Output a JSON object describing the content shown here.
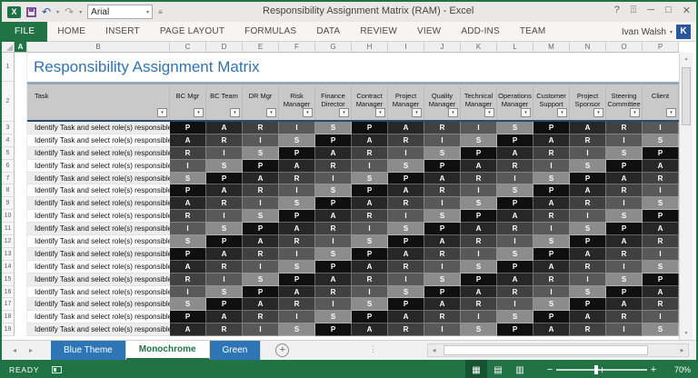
{
  "window": {
    "title": "Responsibility Assignment Matrix (RAM) - Excel",
    "user_name": "Ivan Walsh",
    "user_initial": "K",
    "font_box_value": "Arial"
  },
  "ribbon": {
    "file_tab": "FILE",
    "tabs": [
      "HOME",
      "INSERT",
      "PAGE LAYOUT",
      "FORMULAS",
      "DATA",
      "REVIEW",
      "VIEW",
      "ADD-INS",
      "TEAM"
    ]
  },
  "sheet": {
    "column_letters": [
      "A",
      "B",
      "C",
      "D",
      "E",
      "F",
      "G",
      "H",
      "I",
      "J",
      "K",
      "L",
      "M",
      "N",
      "O",
      "P"
    ],
    "selected_column": "A",
    "row_numbers": [
      "1",
      "2",
      "3",
      "4",
      "5",
      "6",
      "7",
      "8",
      "9",
      "10",
      "11",
      "12",
      "13",
      "14",
      "15",
      "16",
      "17",
      "18",
      "19"
    ],
    "title": "Responsibility Assignment Matrix",
    "headers": [
      "Task",
      "BC Mgr",
      "BC Team",
      "DR Mgr",
      "Risk Manager",
      "Finance Director",
      "Contract Manager",
      "Project Manager",
      "Quality Manager",
      "Technical Manager",
      "Operations Manager",
      "Customer Support",
      "Project Sponsor",
      "Steering Committee",
      "Client"
    ],
    "task_text": "Identify Task and select role(s) responsible",
    "cell_colors": {
      "P": "#0f0f0f",
      "A": "#272727",
      "R": "#414141",
      "I": "#595959",
      "S": "#8c8c8c"
    },
    "band_colors": [
      "#ededed",
      "#fdfdfd"
    ],
    "rows": [
      [
        "P",
        "A",
        "R",
        "I",
        "S",
        "P",
        "A",
        "R",
        "I",
        "S",
        "P",
        "A",
        "R",
        "I"
      ],
      [
        "A",
        "R",
        "I",
        "S",
        "P",
        "A",
        "R",
        "I",
        "S",
        "P",
        "A",
        "R",
        "I",
        "S"
      ],
      [
        "R",
        "I",
        "S",
        "P",
        "A",
        "R",
        "I",
        "S",
        "P",
        "A",
        "R",
        "I",
        "S",
        "P"
      ],
      [
        "I",
        "S",
        "P",
        "A",
        "R",
        "I",
        "S",
        "P",
        "A",
        "R",
        "I",
        "S",
        "P",
        "A"
      ],
      [
        "S",
        "P",
        "A",
        "R",
        "I",
        "S",
        "P",
        "A",
        "R",
        "I",
        "S",
        "P",
        "A",
        "R"
      ],
      [
        "P",
        "A",
        "R",
        "I",
        "S",
        "P",
        "A",
        "R",
        "I",
        "S",
        "P",
        "A",
        "R",
        "I"
      ],
      [
        "A",
        "R",
        "I",
        "S",
        "P",
        "A",
        "R",
        "I",
        "S",
        "P",
        "A",
        "R",
        "I",
        "S"
      ],
      [
        "R",
        "I",
        "S",
        "P",
        "A",
        "R",
        "I",
        "S",
        "P",
        "A",
        "R",
        "I",
        "S",
        "P"
      ],
      [
        "I",
        "S",
        "P",
        "A",
        "R",
        "I",
        "S",
        "P",
        "A",
        "R",
        "I",
        "S",
        "P",
        "A"
      ],
      [
        "S",
        "P",
        "A",
        "R",
        "I",
        "S",
        "P",
        "A",
        "R",
        "I",
        "S",
        "P",
        "A",
        "R"
      ],
      [
        "P",
        "A",
        "R",
        "I",
        "S",
        "P",
        "A",
        "R",
        "I",
        "S",
        "P",
        "A",
        "R",
        "I"
      ],
      [
        "A",
        "R",
        "I",
        "S",
        "P",
        "A",
        "R",
        "I",
        "S",
        "P",
        "A",
        "R",
        "I",
        "S"
      ],
      [
        "R",
        "I",
        "S",
        "P",
        "A",
        "R",
        "I",
        "S",
        "P",
        "A",
        "R",
        "I",
        "S",
        "P"
      ],
      [
        "I",
        "S",
        "P",
        "A",
        "R",
        "I",
        "S",
        "P",
        "A",
        "R",
        "I",
        "S",
        "P",
        "A"
      ],
      [
        "S",
        "P",
        "A",
        "R",
        "I",
        "S",
        "P",
        "A",
        "R",
        "I",
        "S",
        "P",
        "A",
        "R"
      ],
      [
        "P",
        "A",
        "R",
        "I",
        "S",
        "P",
        "A",
        "R",
        "I",
        "S",
        "P",
        "A",
        "R",
        "I"
      ],
      [
        "A",
        "R",
        "I",
        "S",
        "P",
        "A",
        "R",
        "I",
        "S",
        "P",
        "A",
        "R",
        "I",
        "S"
      ]
    ]
  },
  "sheet_tabs": {
    "items": [
      {
        "label": "Blue Theme",
        "active": false
      },
      {
        "label": "Monochrome",
        "active": true
      },
      {
        "label": "Green",
        "active": false
      }
    ]
  },
  "status": {
    "mode": "READY",
    "zoom": "70%"
  }
}
